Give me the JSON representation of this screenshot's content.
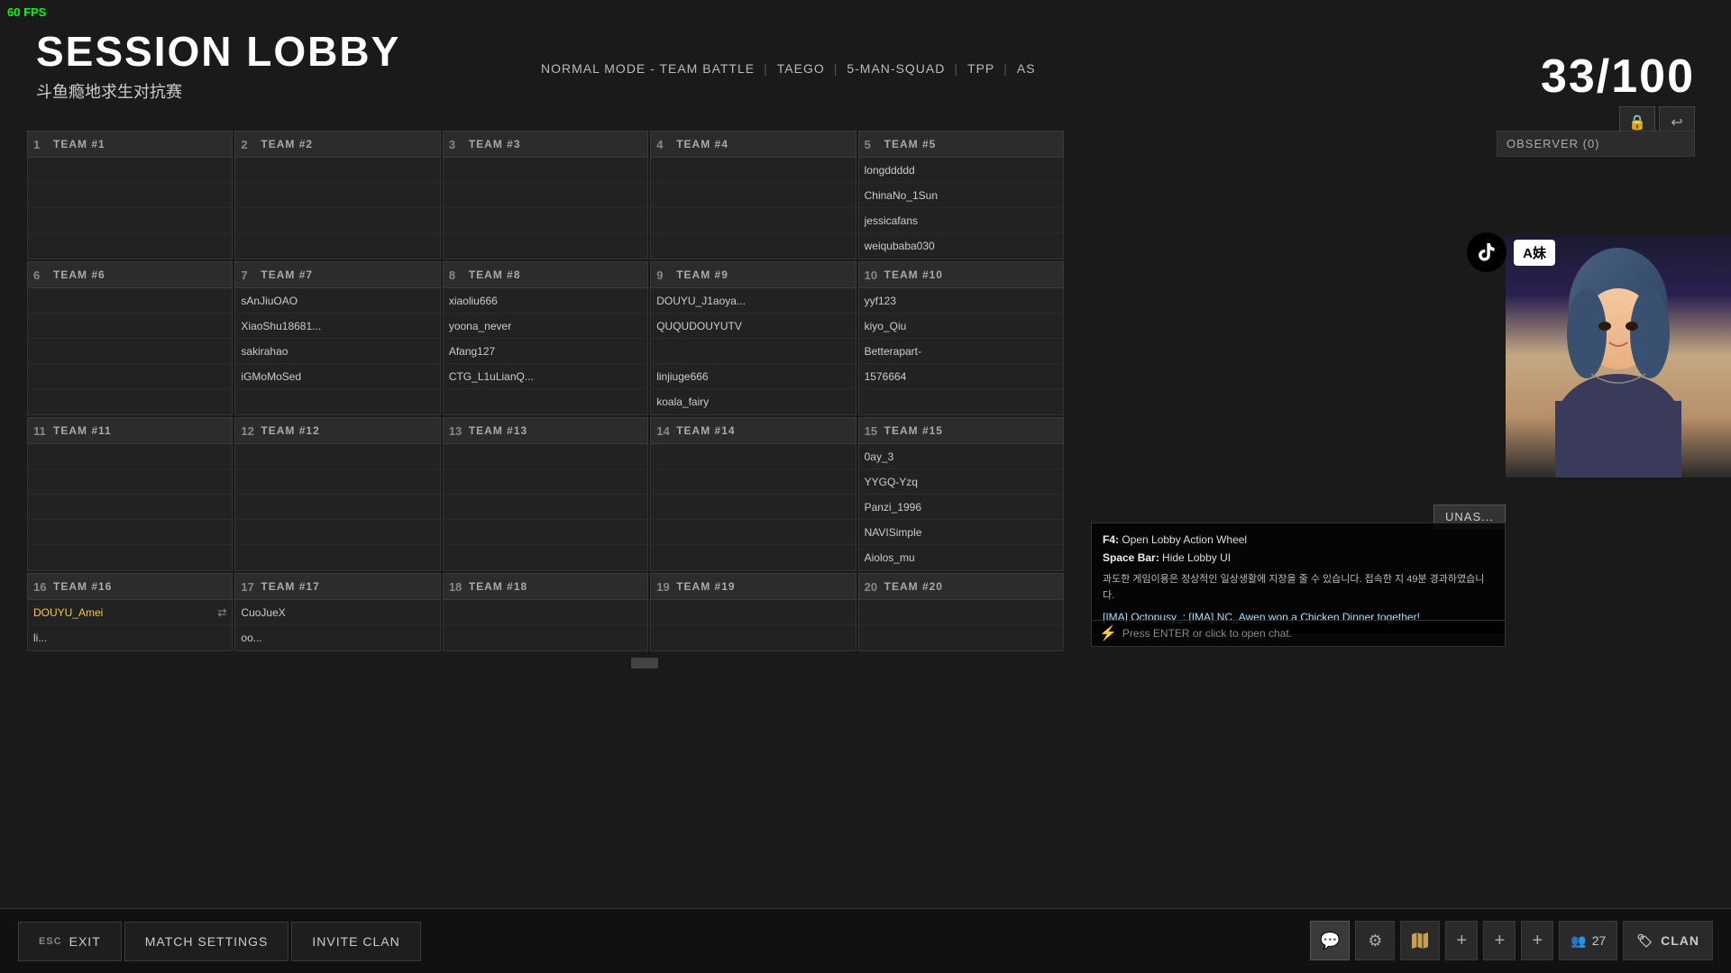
{
  "fps": "60 FPS",
  "header": {
    "title": "SESSION LOBBY",
    "subtitle": "斗鱼瘾地求生对抗赛",
    "player_count": "33/100",
    "mode": "NORMAL MODE - TEAM BATTLE",
    "map": "TAEGO",
    "squad": "5-MAN-SQUAD",
    "perspective": "TPP",
    "region": "AS"
  },
  "observer": {
    "label": "OBSERVER (0)"
  },
  "teams": [
    {
      "num": "1",
      "label": "TEAM #1",
      "players": [
        "",
        "",
        "",
        ""
      ]
    },
    {
      "num": "2",
      "label": "TEAM #2",
      "players": [
        "",
        "",
        "",
        ""
      ]
    },
    {
      "num": "3",
      "label": "TEAM #3",
      "players": [
        "",
        "",
        "",
        ""
      ]
    },
    {
      "num": "4",
      "label": "TEAM #4",
      "players": [
        "",
        "",
        "",
        ""
      ]
    },
    {
      "num": "5",
      "label": "TEAM #5",
      "players": [
        "longddddd",
        "ChinaNo_1Sun",
        "jessicafans",
        "weiqubaba030"
      ]
    },
    {
      "num": "6",
      "label": "TEAM #6",
      "players": [
        "",
        "",
        "",
        ""
      ]
    },
    {
      "num": "7",
      "label": "TEAM #7",
      "players": [
        "sAnJiuOAO",
        "XiaoShu18681...",
        "sakirahao",
        "iGMoMoSed"
      ]
    },
    {
      "num": "8",
      "label": "TEAM #8",
      "players": [
        "xiaoliu666",
        "yoona_never",
        "Afang127",
        "CTG_L1uLianQ..."
      ]
    },
    {
      "num": "9",
      "label": "TEAM #9",
      "players": [
        "DOUYU_J1aoya...",
        "QUQUDOUYUTV",
        "",
        "linjiuge666",
        "koala_fairy"
      ]
    },
    {
      "num": "10",
      "label": "TEAM #10",
      "players": [
        "yyf123",
        "kiyo_Qiu",
        "Betterapart-",
        "1576664"
      ]
    },
    {
      "num": "11",
      "label": "TEAM #11",
      "players": [
        "",
        "",
        "",
        ""
      ]
    },
    {
      "num": "12",
      "label": "TEAM #12",
      "players": [
        "",
        "",
        "",
        ""
      ]
    },
    {
      "num": "13",
      "label": "TEAM #13",
      "players": [
        "",
        "",
        "",
        ""
      ]
    },
    {
      "num": "14",
      "label": "TEAM #14",
      "players": [
        "",
        "",
        "",
        ""
      ]
    },
    {
      "num": "15",
      "label": "TEAM #15",
      "players": [
        "0ay_3",
        "YYGQ-Yzq",
        "Panzi_1996",
        "NAVISimple",
        "Aiolos_mu"
      ]
    },
    {
      "num": "16",
      "label": "TEAM #16",
      "players": [
        "DOUYU_Amei",
        "li..."
      ]
    },
    {
      "num": "17",
      "label": "TEAM #17",
      "players": [
        "CuoJueX",
        "oo..."
      ]
    },
    {
      "num": "18",
      "label": "TEAM #18",
      "players": [
        "",
        ""
      ]
    },
    {
      "num": "19",
      "label": "TEAM #19",
      "players": [
        "",
        ""
      ]
    },
    {
      "num": "20",
      "label": "TEAM #20",
      "players": [
        "",
        ""
      ]
    }
  ],
  "hotkeys": [
    {
      "key": "F4:",
      "action": "Open Lobby Action Wheel"
    },
    {
      "key": "Space Bar:",
      "action": "Hide Lobby UI"
    }
  ],
  "warning": "과도한 게임이용은 정상적인 일상생활에 지장을 줄 수 있습니다. 접속한 지 49분 경과하였습니다.",
  "chat_message": "[IMA] Octopusy_; [IMA] NC_Awen won a Chicken Dinner together!",
  "chat_placeholder": "Press ENTER or click to open chat.",
  "tiktok_label": "A妹",
  "unas_label": "UNAS...",
  "bottom": {
    "exit_key": "ESC",
    "exit_label": "EXIT",
    "match_settings": "MATCH SETTINGS",
    "invite_clan": "INVITE CLAN",
    "player_count": "27",
    "clan_label": "CLAN"
  },
  "icons": {
    "lock": "🔒",
    "back": "↩",
    "bolt": "⚡",
    "chat": "💬",
    "globe": "🌐",
    "map": "🗺",
    "plus": "+",
    "people": "👥",
    "clan": "🏷"
  }
}
